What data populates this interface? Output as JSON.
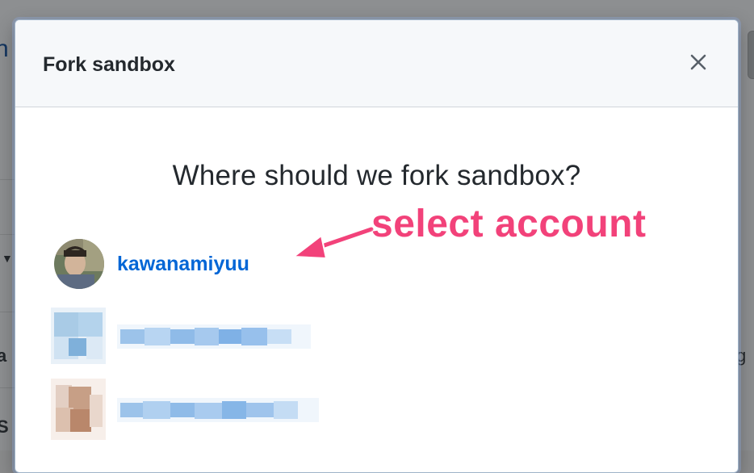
{
  "dialog": {
    "title": "Fork sandbox",
    "question": "Where should we fork sandbox?",
    "close_icon": "close-icon"
  },
  "accounts": [
    {
      "name": "kawanamiyuu",
      "avatar": "avatar-photo"
    },
    {
      "name": "",
      "avatar": "blurred-avatar-blue",
      "blurred": true
    },
    {
      "name": "",
      "avatar": "blurred-avatar-skin",
      "blurred": true
    }
  ],
  "annotation": {
    "text": "select account",
    "color": "#f2427a",
    "arrow_icon": "arrow-left-icon"
  },
  "colors": {
    "link": "#0366d6",
    "header_bg": "#f6f8fa",
    "overlay": "rgba(27,31,35,0.5)"
  }
}
